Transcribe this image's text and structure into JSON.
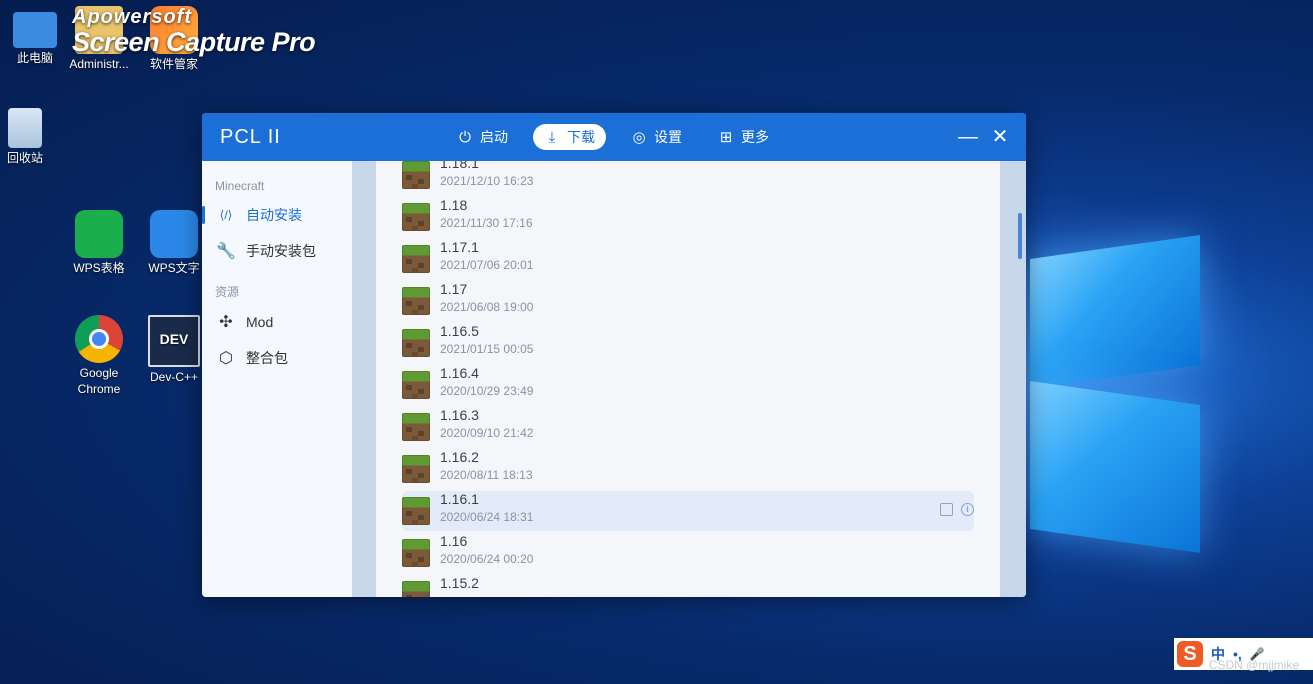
{
  "desktop": {
    "icons": [
      {
        "label": "此电脑"
      },
      {
        "label": "Administr..."
      },
      {
        "label": "软件管家"
      },
      {
        "label": "回收站"
      },
      {
        "label": "WPS表格"
      },
      {
        "label": "WPS文字"
      },
      {
        "label": "Google Chrome"
      },
      {
        "label": "Dev-C++"
      }
    ],
    "overlay_line1": "Apowersoft",
    "overlay_line2": "Screen Capture Pro",
    "dev_glyph": "DEV"
  },
  "window": {
    "title": "PCL II",
    "nav": [
      {
        "label": "启动",
        "icon": "power-icon",
        "glyph": "⏻"
      },
      {
        "label": "下载",
        "icon": "download-icon",
        "glyph": "⤓"
      },
      {
        "label": "设置",
        "icon": "settings-icon",
        "glyph": "◎"
      },
      {
        "label": "更多",
        "icon": "grid-icon",
        "glyph": "⊞"
      }
    ],
    "minimize": "—",
    "close": "✕"
  },
  "sidebar": {
    "section1": "Minecraft",
    "items1": [
      {
        "label": "自动安装",
        "icon": "code-icon",
        "glyph": "⟨/⟩"
      },
      {
        "label": "手动安装包",
        "icon": "wrench-icon",
        "glyph": "🔧"
      }
    ],
    "section2": "资源",
    "items2": [
      {
        "label": "Mod",
        "icon": "puzzle-icon",
        "glyph": "✣"
      },
      {
        "label": "整合包",
        "icon": "box-icon",
        "glyph": "⬡"
      }
    ]
  },
  "versions": [
    {
      "name": "1.18.1",
      "date": "2021/12/10 16:23"
    },
    {
      "name": "1.18",
      "date": "2021/11/30 17:16"
    },
    {
      "name": "1.17.1",
      "date": "2021/07/06 20:01"
    },
    {
      "name": "1.17",
      "date": "2021/06/08 19:00"
    },
    {
      "name": "1.16.5",
      "date": "2021/01/15 00:05"
    },
    {
      "name": "1.16.4",
      "date": "2020/10/29 23:49"
    },
    {
      "name": "1.16.3",
      "date": "2020/09/10 21:42"
    },
    {
      "name": "1.16.2",
      "date": "2020/08/11 18:13"
    },
    {
      "name": "1.16.1",
      "date": "2020/06/24 18:31"
    },
    {
      "name": "1.16",
      "date": "2020/06/24 00:20"
    },
    {
      "name": "1.15.2",
      "date": ""
    }
  ],
  "row_actions": {
    "info_glyph": "i"
  },
  "tray": {
    "ime": "S",
    "lang": "中",
    "punct": "•,",
    "mic": "🎤"
  },
  "watermark": "CSDN @mjjmike",
  "colors": {
    "accent": "#1b6fd6"
  }
}
